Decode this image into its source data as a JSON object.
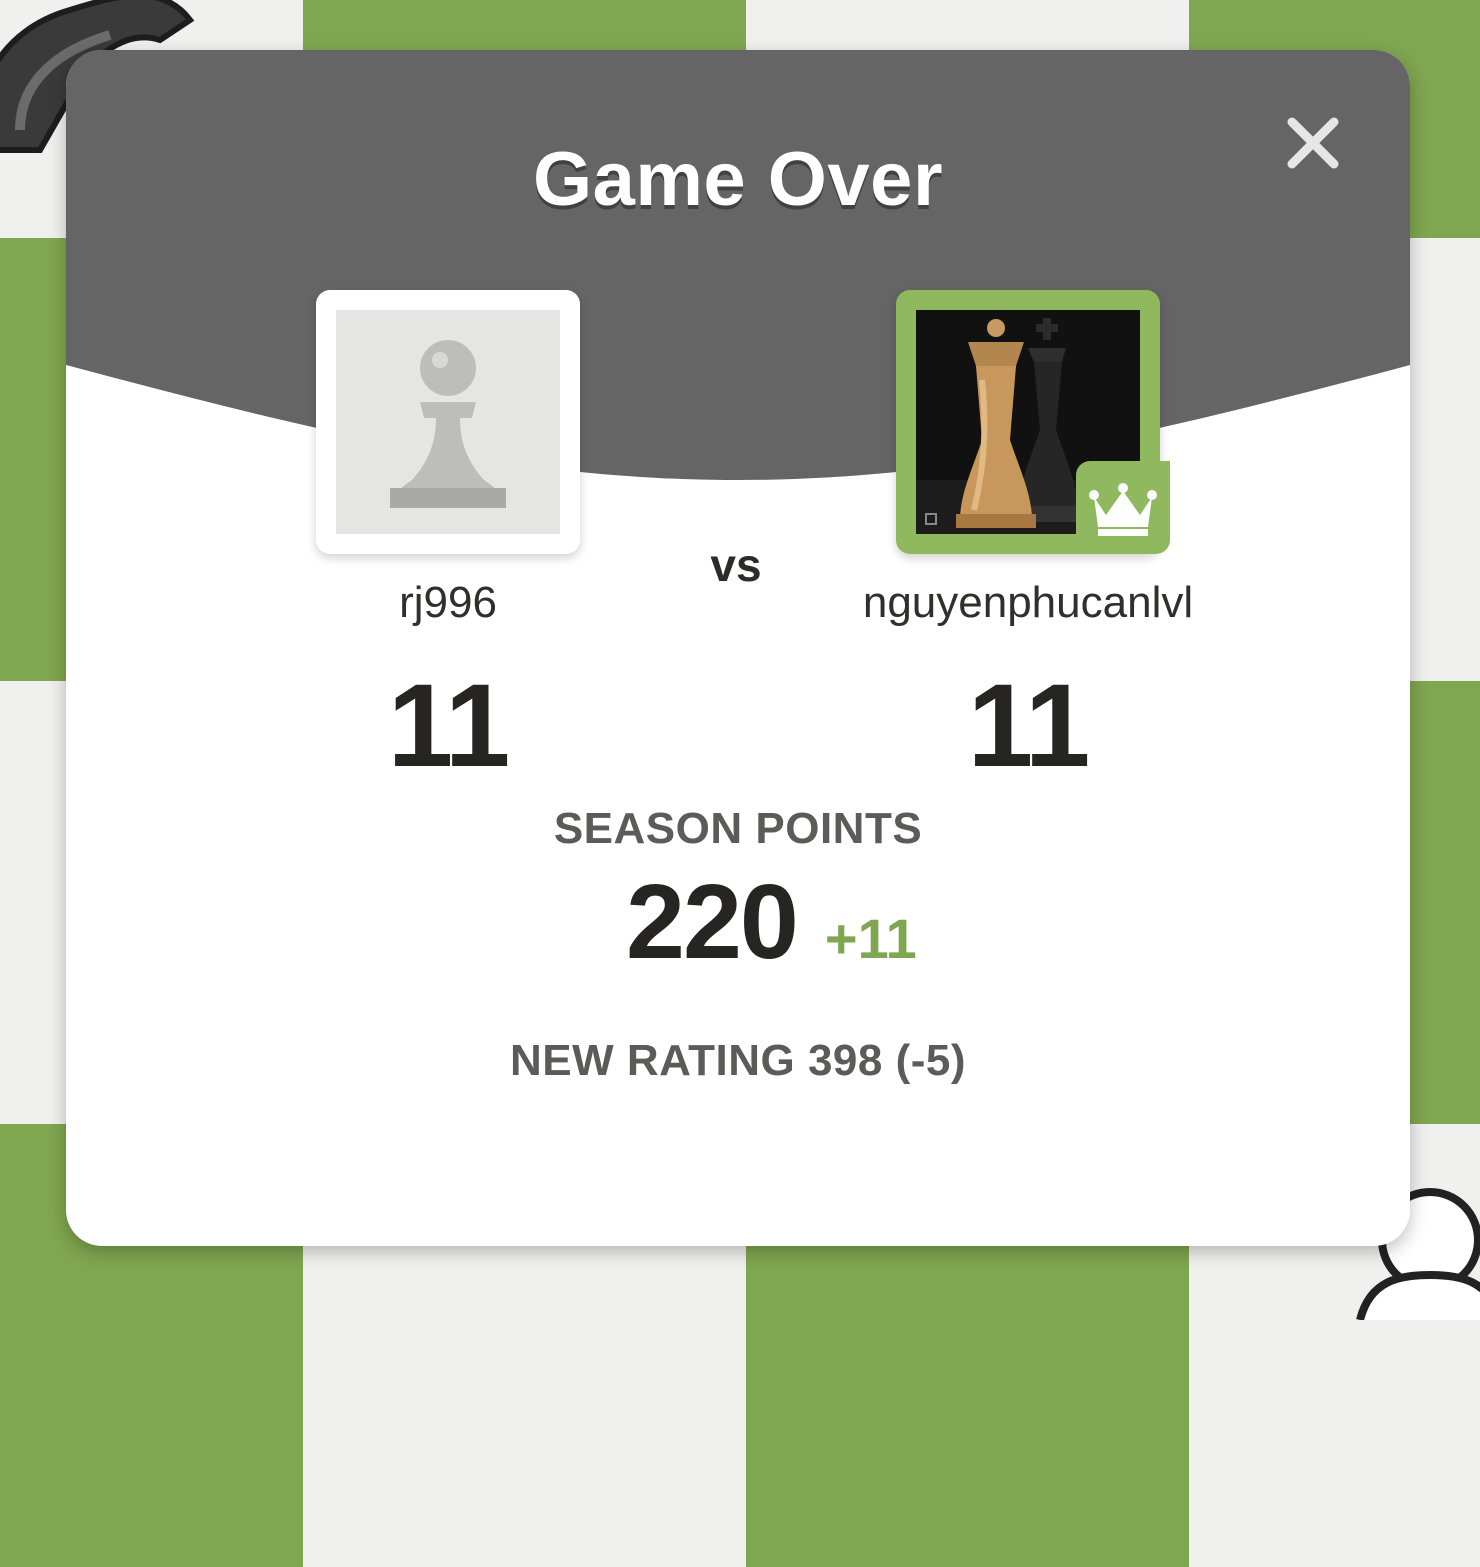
{
  "dialog": {
    "title": "Game Over",
    "close_icon": "close-icon"
  },
  "players": {
    "left": {
      "username": "rj996",
      "score": "11",
      "avatar_icon": "pawn-avatar-icon"
    },
    "right": {
      "username": "nguyenphucanlvl",
      "score": "11",
      "avatar_icon": "chess-kings-photo-avatar",
      "badge_icon": "crown-icon"
    }
  },
  "versus_label": "vs",
  "season": {
    "label": "SEASON POINTS",
    "value": "220",
    "delta": "+11"
  },
  "rating_text": "NEW RATING 398 (-5)",
  "colors": {
    "header_gray": "#656565",
    "board_dark": "#7fa650",
    "board_light": "#f0f0ee",
    "accent_green": "#7fa650",
    "badge_green": "#8fb85f"
  }
}
